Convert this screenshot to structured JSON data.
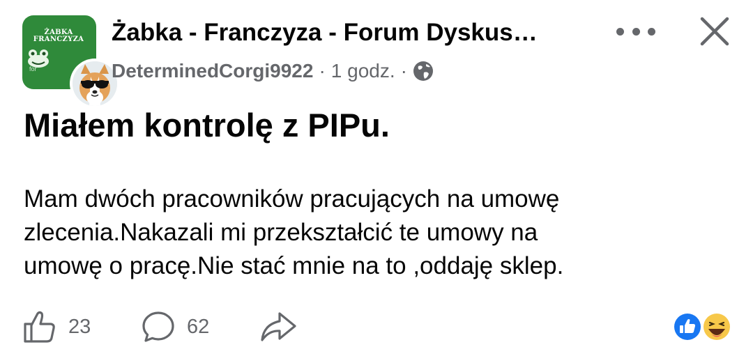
{
  "group": {
    "name": "Żabka - Franczyza - Forum Dyskus…",
    "logo_line1": "ŻABKA",
    "logo_line2": "FRANCZYZA",
    "logo_sub": "for"
  },
  "meta": {
    "author": "DeterminedCorgi9922",
    "separator": "·",
    "time": "1 godz.",
    "privacy_icon": "globe-icon"
  },
  "header_actions": {
    "more_icon": "more-horizontal-icon",
    "close_icon": "close-icon"
  },
  "post": {
    "title": "Miałem kontrolę z PIPu.",
    "body_lines": [
      "Mam dwóch pracowników pracujących na umowę",
      "zlecenia.Nakazali mi przekształcić te umowy na",
      "umowę o pracę.Nie stać mnie na to ,oddaję sklep."
    ]
  },
  "actions": {
    "likes": "23",
    "comments": "62",
    "like_icon": "thumbs-up-icon",
    "comment_icon": "comment-bubble-icon",
    "share_icon": "share-arrow-icon"
  },
  "reactions": {
    "icons": [
      "like-reaction-icon",
      "haha-reaction-icon"
    ],
    "like_color": "#1877f2",
    "haha_color": "#f7c84a"
  },
  "colors": {
    "primary_text": "#050505",
    "secondary_text": "#65676b",
    "logo_green": "#2f8a3a"
  }
}
